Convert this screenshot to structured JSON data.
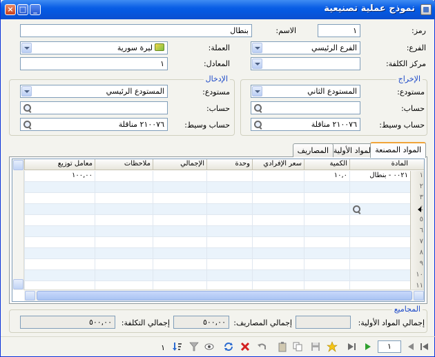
{
  "window": {
    "title": "نموذج عملية تصنيعية",
    "close": "×",
    "maximize": "□",
    "minimize": "_"
  },
  "form": {
    "code_label": "رمز:",
    "code_value": "١",
    "name_label": "الاسم:",
    "name_value": "بنطال",
    "branch_label": "الفرع:",
    "branch_value": "الفرع الرئيسي",
    "currency_label": "العملة:",
    "currency_value": "ليرة سورية",
    "cost_center_label": "مركز الكلفة:",
    "cost_center_value": "",
    "rate_label": "المعادل:",
    "rate_value": "١"
  },
  "output_group": {
    "title": "الإخراج",
    "warehouse_label": "مستودع:",
    "warehouse_value": "المستودع الثاني",
    "account_label": "حساب:",
    "account_value": "",
    "intermediate_label": "حساب وسيط:",
    "intermediate_value": "٢١٠٠٧٦ مناقلة"
  },
  "input_group": {
    "title": "الإدخال",
    "warehouse_label": "مستودع:",
    "warehouse_value": "المستودع الرئيسي",
    "account_label": "حساب:",
    "account_value": "",
    "intermediate_label": "حساب وسيط:",
    "intermediate_value": "٢١٠٠٧٦ مناقلة"
  },
  "tabs": [
    {
      "label": "المواد المصنعة"
    },
    {
      "label": "المواد الأولية"
    },
    {
      "label": "المصاريف"
    }
  ],
  "grid": {
    "columns": [
      "المادة",
      "الكمية",
      "سعر الإفرادي",
      "وحدة",
      "الإجمالي",
      "ملاحظات",
      "معامل توزيع"
    ],
    "rows": [
      {
        "num": "١",
        "item": "٠٠٢١ - بنطال",
        "qty": "١٠,٠",
        "factor": "١٠٠,٠٠"
      },
      {
        "num": "٢"
      },
      {
        "num": "٣"
      },
      {
        "num": "٤"
      },
      {
        "num": "٥"
      },
      {
        "num": "٦"
      },
      {
        "num": "٧"
      },
      {
        "num": "٨"
      },
      {
        "num": "٩"
      },
      {
        "num": "١٠"
      },
      {
        "num": "١١"
      }
    ]
  },
  "totals": {
    "title": "المجاميع",
    "raw_label": "إجمالي المواد الأولية:",
    "raw_value": "",
    "expenses_label": "إجمالي المصاريف:",
    "expenses_value": "٥٠٠,٠٠",
    "cost_label": "إجمالي التكلفة:",
    "cost_value": "٥٠٠,٠٠"
  },
  "toolbar": {
    "record_number": "١",
    "count": "١"
  },
  "colors": {
    "titlebar": "#0a5ee5",
    "group_title": "#1c49c8",
    "tab_highlight": "#f0a438"
  }
}
